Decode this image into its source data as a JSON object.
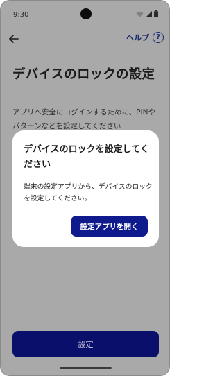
{
  "status_bar": {
    "time": "9:30",
    "icons": [
      "wifi-icon",
      "signal-icon",
      "battery-icon"
    ]
  },
  "app_bar": {
    "back_icon": "arrow-left-icon",
    "help_label": "ヘルプ",
    "help_icon_glyph": "?"
  },
  "page": {
    "title": "デバイスのロックの設定",
    "description": "アプリへ安全にログインするために、PINやパターンなどを設定してください"
  },
  "dialog": {
    "title": "デバイスのロックを設定してください",
    "body": "端末の設定アプリから、デバイスのロックを設定してください。",
    "button_label": "設定アプリを開く"
  },
  "footer": {
    "button_label": "設定"
  },
  "colors": {
    "accent": "#0f1a8c",
    "help_text": "#1a2a6e",
    "scrim": "#a9a9a9"
  }
}
